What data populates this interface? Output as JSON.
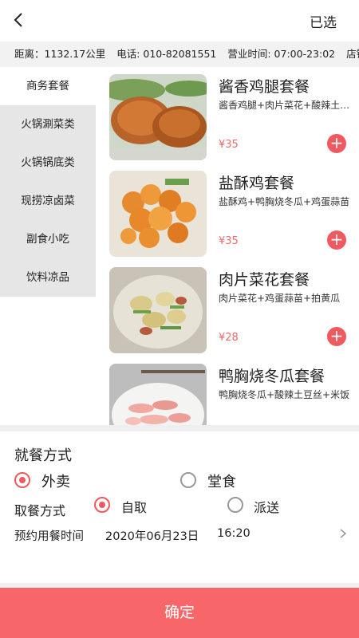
{
  "header": {
    "back_icon": "back-arrow-icon",
    "selected_label": "已选"
  },
  "info": {
    "distance": "距离：1132.17公里",
    "phone": "电话: 010-82081551",
    "hours": "营业时间: 07:00-23:02",
    "store": "店铺"
  },
  "sidebar": {
    "items": [
      {
        "label": "商务套餐"
      },
      {
        "label": "火锅涮菜类"
      },
      {
        "label": "火锅锅底类"
      },
      {
        "label": "现捞凉卤菜"
      },
      {
        "label": "副食小吃"
      },
      {
        "label": "饮料凉品"
      }
    ]
  },
  "menu": {
    "items": [
      {
        "name": "酱香鸡腿套餐",
        "desc": "酱香鸡腿+肉片菜花+酸辣土豆丝",
        "price": "¥35",
        "add_icon": "plus-icon"
      },
      {
        "name": "盐酥鸡套餐",
        "desc": "盐酥鸡+鸭胸烧冬瓜+鸡蛋蒜苗",
        "price": "¥35",
        "add_icon": "plus-icon"
      },
      {
        "name": "肉片菜花套餐",
        "desc": "肉片菜花+鸡蛋蒜苗+拍黄瓜",
        "price": "¥28",
        "add_icon": "plus-icon"
      },
      {
        "name": "鸭胸烧冬瓜套餐",
        "desc": "鸭胸烧冬瓜+酸辣土豆丝+米饭",
        "price": "",
        "add_icon": "plus-icon"
      }
    ]
  },
  "order": {
    "dine_title": "就餐方式",
    "dine_options": [
      {
        "label": "外卖",
        "selected": true
      },
      {
        "label": "堂食",
        "selected": false
      }
    ],
    "pickup_title": "取餐方式",
    "pickup_options": [
      {
        "label": "自取",
        "selected": true
      },
      {
        "label": "派送",
        "selected": false
      }
    ],
    "time_label": "预约用餐时间",
    "time_date": "2020年06月23日",
    "time_hour": "16:20",
    "time_chevron": "chevron-right-icon"
  },
  "confirm_label": "确定",
  "colors": {
    "accent": "#ee5a5f",
    "confirm": "#f76668",
    "sidebar_bg": "#e6e6e6"
  }
}
